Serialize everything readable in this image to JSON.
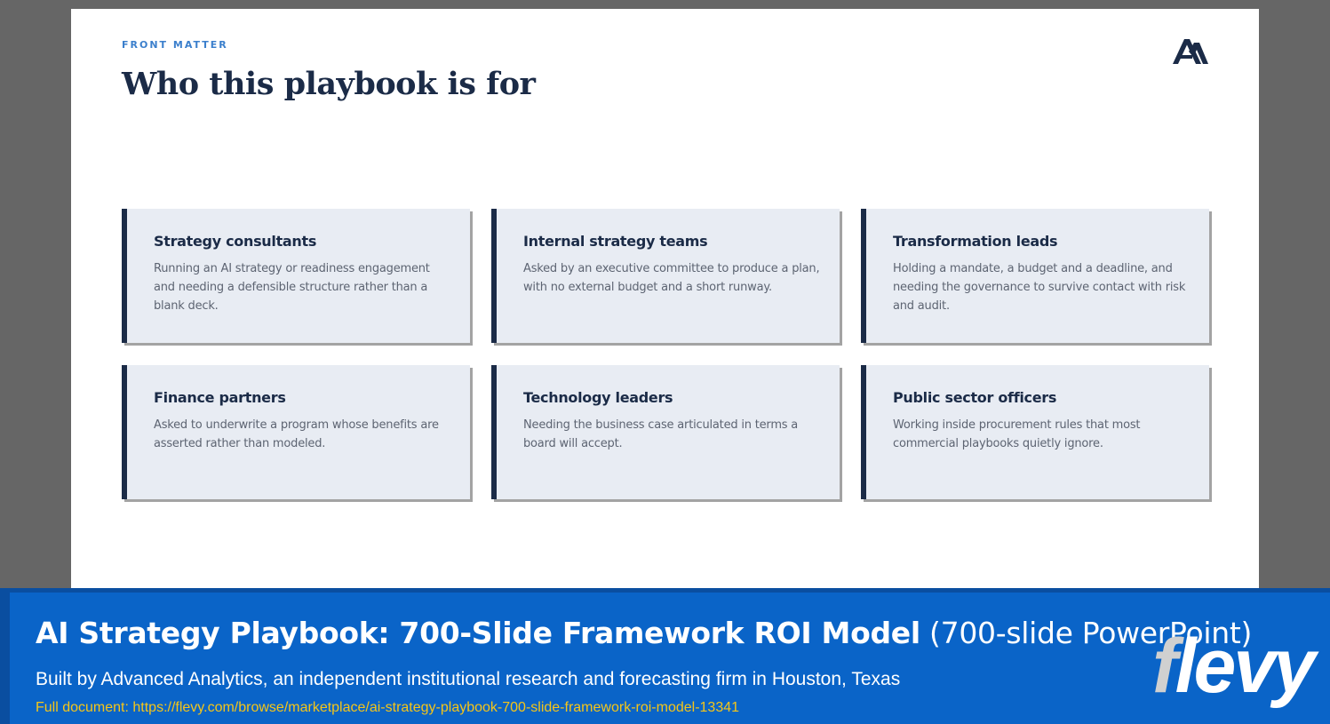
{
  "slide": {
    "eyebrow": "FRONT MATTER",
    "title": "Who this playbook is for",
    "logo_icon": "mountain-logo-icon",
    "cards": [
      {
        "title": "Strategy consultants",
        "body": "Running an AI strategy or readiness engagement and needing a defensible structure rather than a blank deck."
      },
      {
        "title": "Internal strategy teams",
        "body": "Asked by an executive committee to produce a plan, with no external budget and a short runway."
      },
      {
        "title": "Transformation leads",
        "body": "Holding a mandate, a budget and a deadline, and needing the governance to survive contact with risk and audit."
      },
      {
        "title": "Finance partners",
        "body": "Asked to underwrite a program whose benefits are asserted rather than modeled."
      },
      {
        "title": "Technology leaders",
        "body": "Needing the business case articulated in terms a board will accept."
      },
      {
        "title": "Public sector officers",
        "body": "Working inside procurement rules that most commercial playbooks quietly ignore."
      }
    ]
  },
  "banner": {
    "title_bold": "AI Strategy Playbook: 700-Slide Framework ROI Model",
    "title_light": " (700-slide PowerPoint)",
    "subtitle": "Built by Advanced Analytics, an independent institutional research and forecasting firm in Houston, Texas",
    "link": "Full document: https://flevy.com/browse/marketplace/ai-strategy-playbook-700-slide-framework-roi-model-13341",
    "brand_f": "f",
    "brand_rest": "levy"
  },
  "colors": {
    "navy": "#1b2b47",
    "accent_blue": "#3b7fcc",
    "card_bg": "#e8ecf3",
    "banner_blue": "#0a64c8",
    "link_yellow": "#f5c518"
  }
}
